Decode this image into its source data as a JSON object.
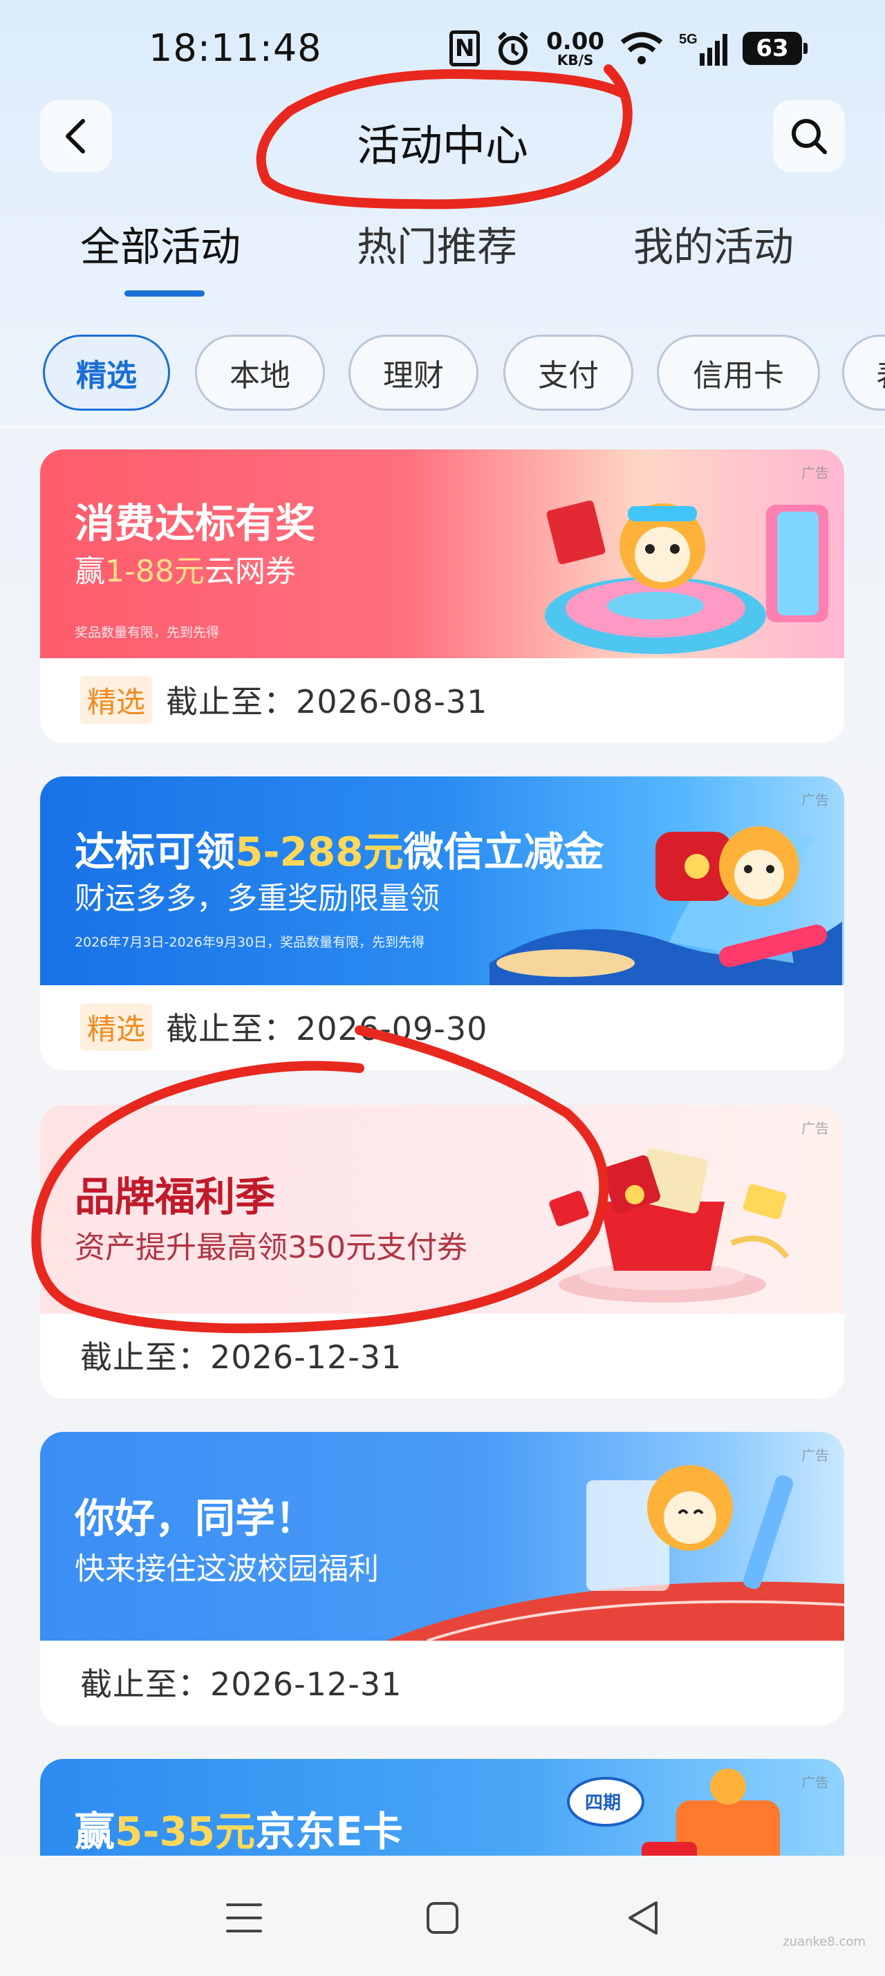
{
  "status_bar": {
    "time": "18:11:48",
    "nfc_icon": "N",
    "net_speed_value": "0.00",
    "net_speed_unit": "KB/S",
    "network": "5G",
    "battery": "63"
  },
  "header": {
    "title": "活动中心",
    "back_icon": "chevron-left-icon",
    "search_icon": "search-icon"
  },
  "tabs": [
    {
      "label": "全部活动",
      "active": true
    },
    {
      "label": "热门推荐",
      "active": false
    },
    {
      "label": "我的活动",
      "active": false
    }
  ],
  "chips": [
    {
      "label": "精选",
      "active": true
    },
    {
      "label": "本地",
      "active": false
    },
    {
      "label": "理财",
      "active": false
    },
    {
      "label": "支付",
      "active": false
    },
    {
      "label": "信用卡",
      "active": false
    },
    {
      "label": "表",
      "active": false
    }
  ],
  "cards": [
    {
      "ad_tag": "广告",
      "title": "消费达标有奖",
      "subtitle_prefix": "赢",
      "subtitle_highlight": "1-88元",
      "subtitle_suffix": "云网券",
      "fine_print": "奖品数量有限，先到先得",
      "tag": "精选",
      "deadline": "截止至：2026-08-31"
    },
    {
      "ad_tag": "广告",
      "title_prefix": "达标可领",
      "title_highlight": "5-288元",
      "title_suffix": "微信立减金",
      "subtitle": "财运多多，多重奖励限量领",
      "fine_print": "2026年7月3日-2026年9月30日，奖品数量有限，先到先得",
      "tag": "精选",
      "deadline": "截止至：2026-09-30"
    },
    {
      "ad_tag": "广告",
      "title": "品牌福利季",
      "subtitle": "资产提升最高领350元支付券",
      "deadline": "截止至：2026-12-31"
    },
    {
      "ad_tag": "广告",
      "title": "你好，同学！",
      "subtitle": "快来接住这波校园福利",
      "deadline": "截止至：2026-12-31"
    },
    {
      "ad_tag": "广告",
      "title_prefix": "赢",
      "title_highlight": "5-35元",
      "title_suffix": "京东E卡",
      "badge": "四期"
    }
  ],
  "navbar": {
    "menu_icon": "menu-icon",
    "home_icon": "square-home-icon",
    "back_icon": "triangle-back-icon"
  },
  "watermark": "zuanke8.com",
  "colors": {
    "accent": "#1a6fd6",
    "tag_pick": "#f08a1c",
    "annotation_red": "#e8281e"
  }
}
